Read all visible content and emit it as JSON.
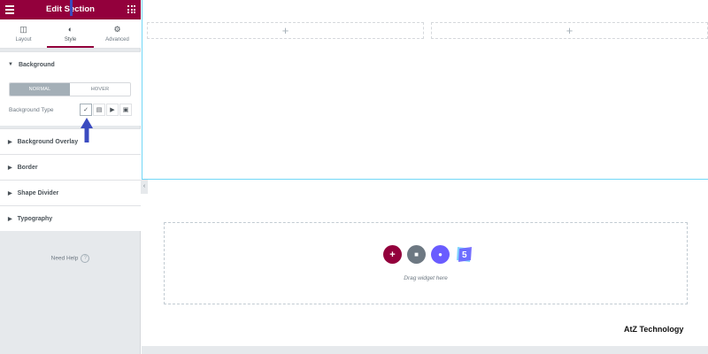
{
  "header": {
    "title": "Edit Section"
  },
  "tabs": [
    {
      "label": "Layout",
      "icon": "columns-icon"
    },
    {
      "label": "Style",
      "icon": "half-circle-icon",
      "active": true
    },
    {
      "label": "Advanced",
      "icon": "gear-icon"
    }
  ],
  "background": {
    "title": "Background",
    "normal_label": "NORMAL",
    "hover_label": "HOVER",
    "type_label": "Background Type",
    "type_options": [
      "brush-icon",
      "gradient-icon",
      "video-icon",
      "slideshow-icon"
    ]
  },
  "sections": {
    "overlay": "Background Overlay",
    "border": "Border",
    "shape": "Shape Divider",
    "typography": "Typography"
  },
  "help": {
    "label": "Need Help"
  },
  "canvas": {
    "drag_hint": "Drag widget here",
    "watermark": "AtZ Technology"
  },
  "colors": {
    "brand": "#93003c",
    "accent_blue": "#3b4bc0",
    "section_outline": "#71d7f7"
  }
}
